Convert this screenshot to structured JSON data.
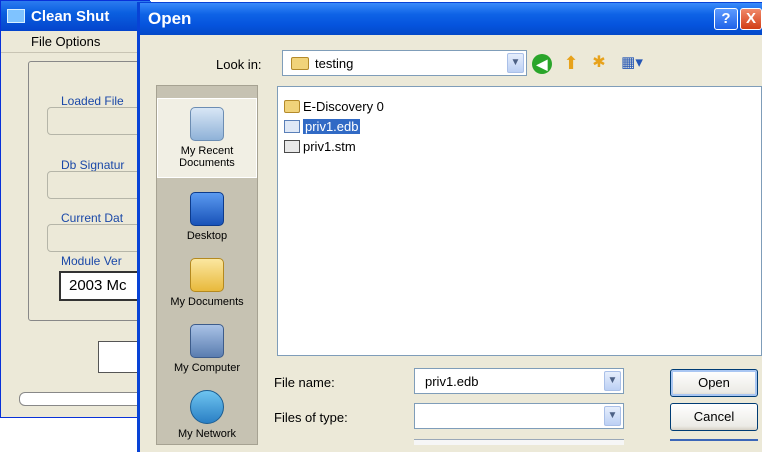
{
  "background_window": {
    "title": "Clean Shut",
    "menu": [
      "File Options"
    ],
    "fields": [
      {
        "label": "Loaded File"
      },
      {
        "label": "Db Signatur"
      },
      {
        "label": "Current Dat"
      },
      {
        "label": "Module Ver",
        "value": "2003 Mc"
      }
    ]
  },
  "dialog": {
    "title": "Open",
    "help_icon": "?",
    "close_icon": "X",
    "look_in_label": "Look in:",
    "look_in_value": "testing",
    "toolbar_icons": [
      "back-icon",
      "up-folder-icon",
      "new-folder-icon",
      "views-menu-icon"
    ],
    "places": [
      {
        "label": "My Recent Documents",
        "icon": "recent-documents-icon",
        "selected": true
      },
      {
        "label": "Desktop",
        "icon": "desktop-icon"
      },
      {
        "label": "My Documents",
        "icon": "my-documents-icon"
      },
      {
        "label": "My Computer",
        "icon": "my-computer-icon"
      },
      {
        "label": "My Network",
        "icon": "my-network-icon"
      }
    ],
    "files": [
      {
        "name": "E-Discovery 0",
        "icon": "folder-icon"
      },
      {
        "name": "priv1.edb",
        "icon": "edb-file-icon",
        "selected": true
      },
      {
        "name": "priv1.stm",
        "icon": "stm-file-icon"
      }
    ],
    "file_name_label": "File name:",
    "file_name_value": "priv1.edb",
    "files_of_type_label": "Files of type:",
    "files_of_type_value": "",
    "open_button": "Open",
    "cancel_button": "Cancel"
  },
  "colors": {
    "title_bar": "#0553dd",
    "selection": "#316ac5",
    "dialog_bg": "#ece9d8"
  }
}
